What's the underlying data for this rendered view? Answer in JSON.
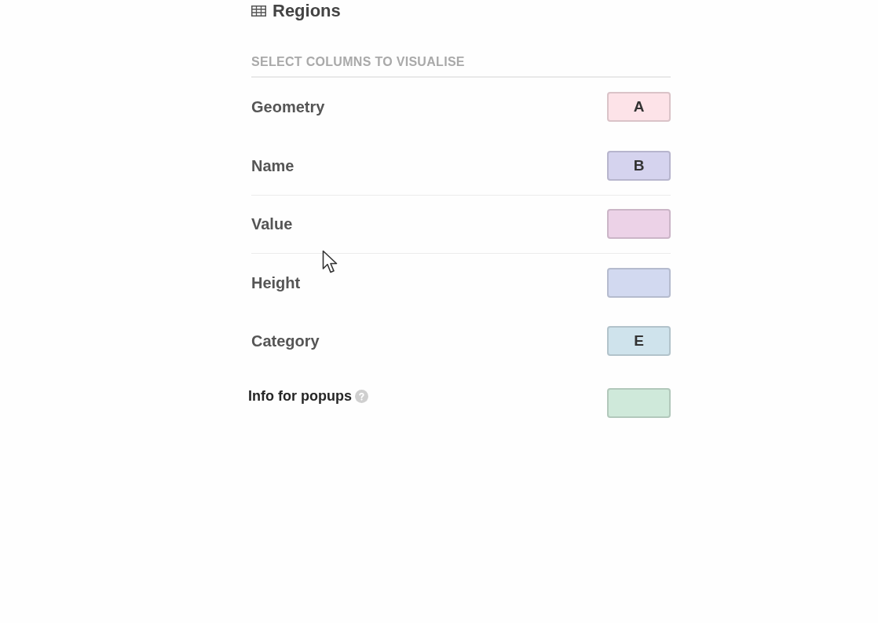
{
  "panel": {
    "title": "Regions"
  },
  "section": {
    "heading": "SELECT COLUMNS TO VISUALISE"
  },
  "rows": [
    {
      "kind": "column",
      "label": "Geometry",
      "color": "#fde3e8",
      "letter": "A",
      "highlighted": false
    },
    {
      "kind": "column",
      "label": "Name",
      "color": "#d5d3ee",
      "letter": "B",
      "highlighted": false
    },
    {
      "kind": "column",
      "label": "Value",
      "color": "#ecd2e7",
      "highlighted": true
    },
    {
      "kind": "column",
      "label": "Height",
      "color": "#d2d9f0",
      "highlighted": false
    },
    {
      "kind": "column",
      "label": "Category",
      "color": "#cfe3ec",
      "letter": "E",
      "highlighted": false
    },
    {
      "kind": "info",
      "label": "Info for popups",
      "color": "#cfe9da",
      "highlighted": false
    }
  ]
}
